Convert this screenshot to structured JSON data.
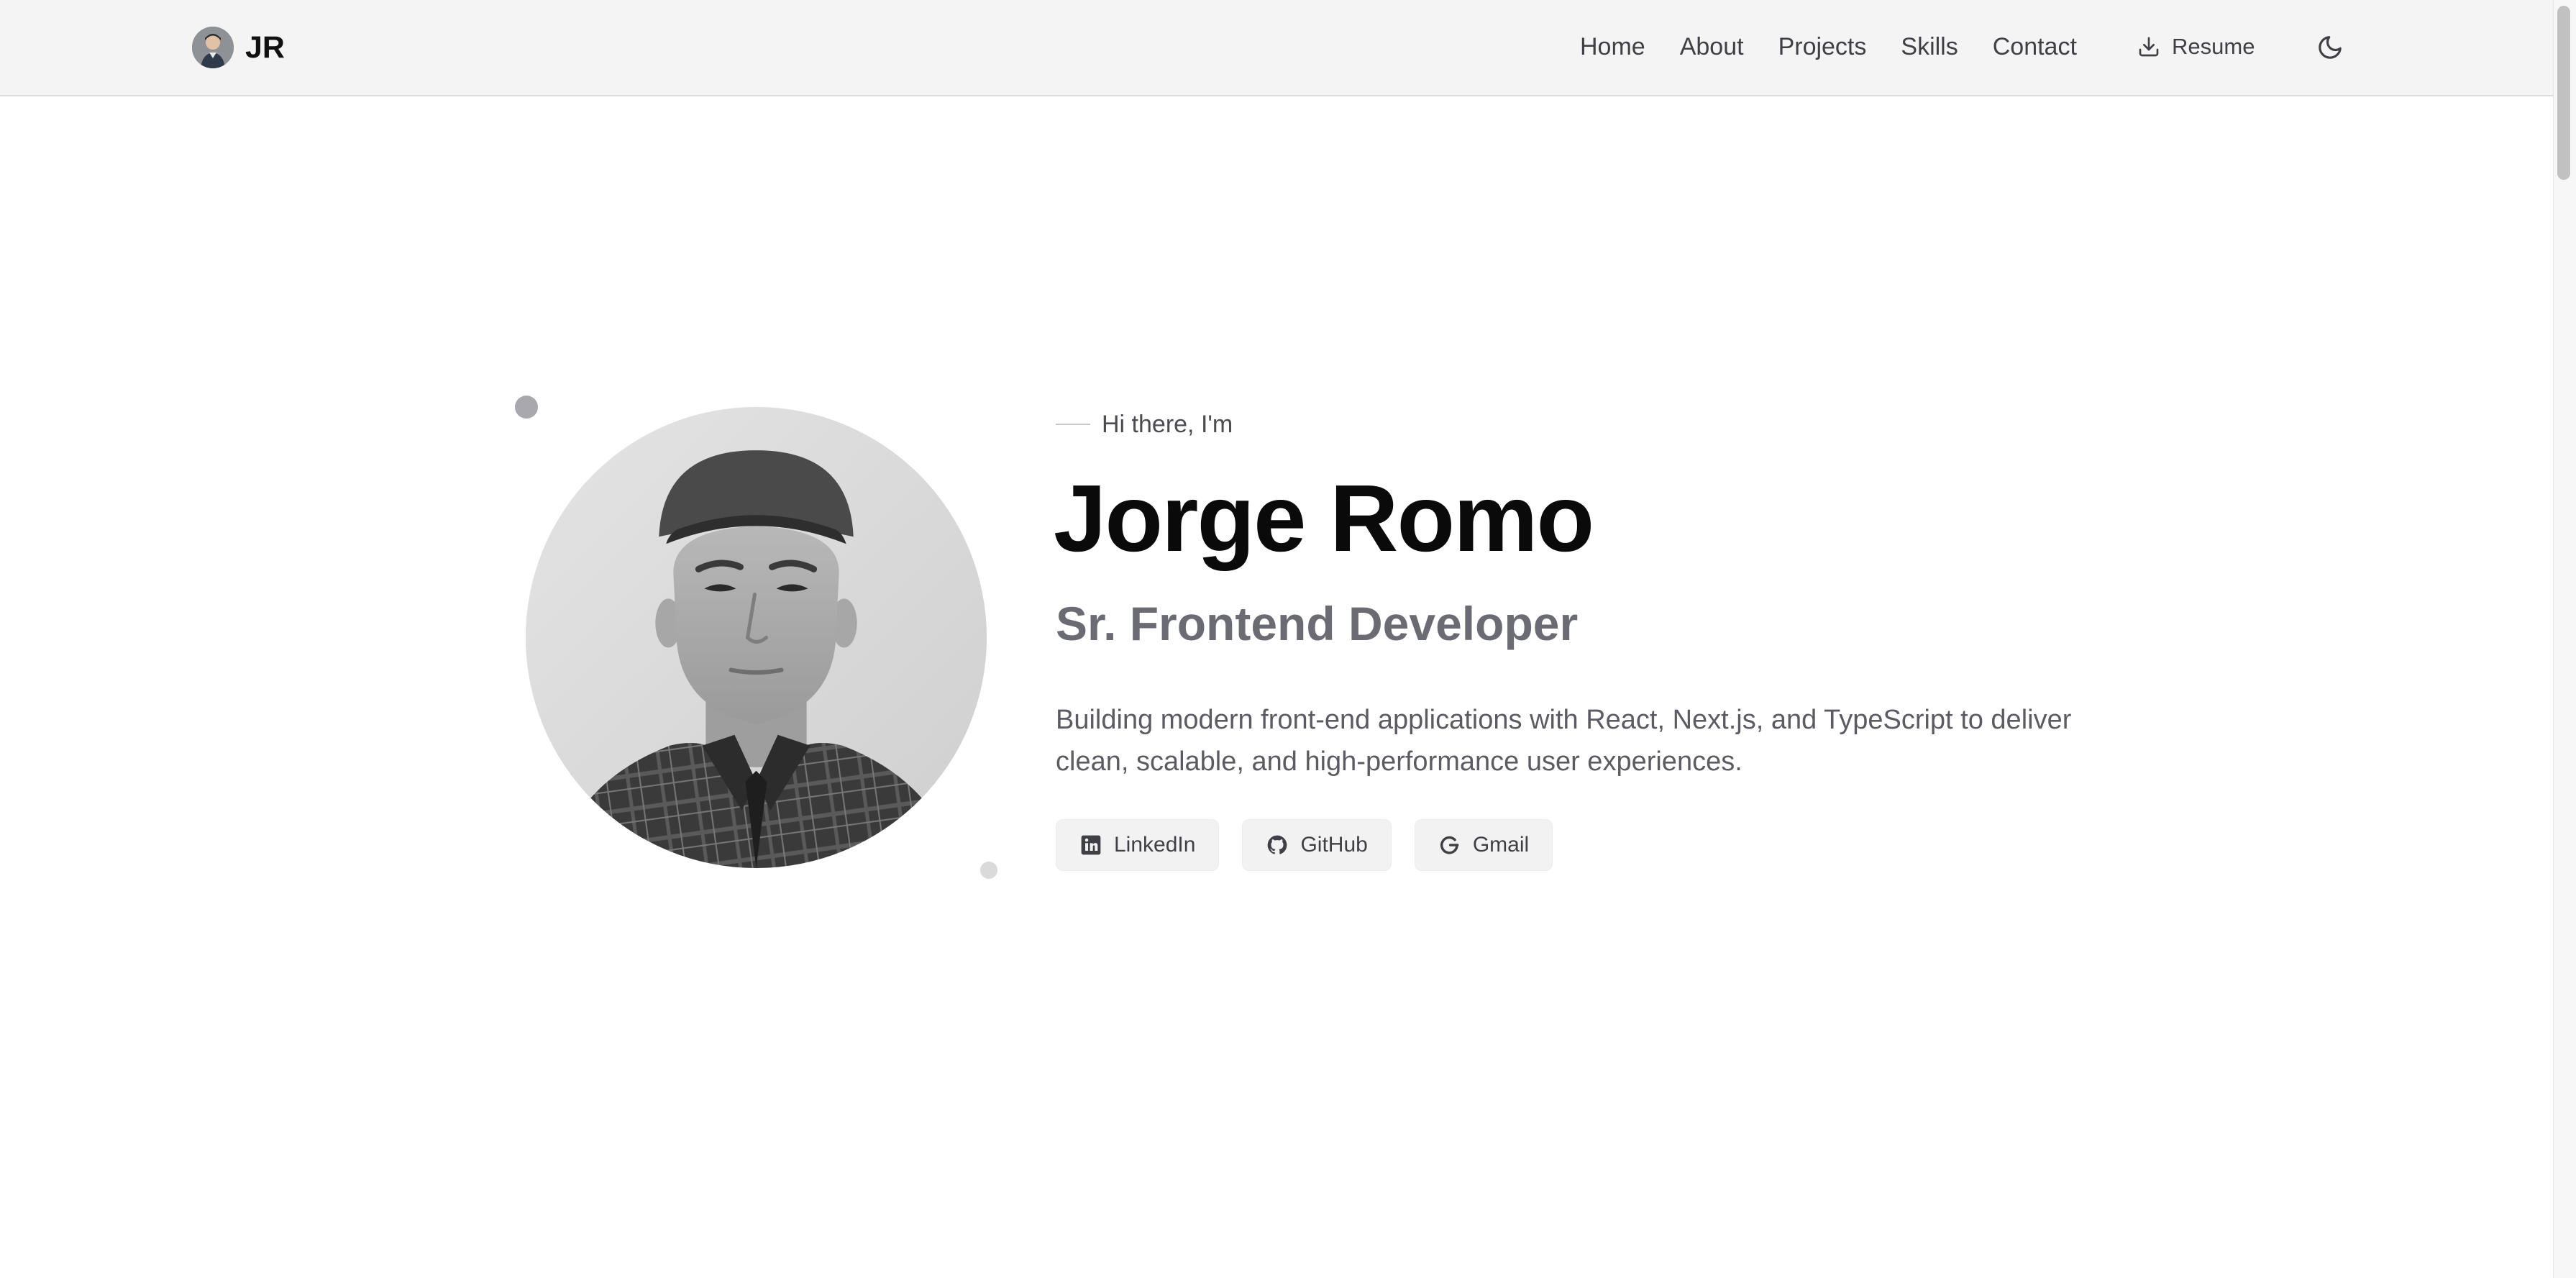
{
  "brand": {
    "initials": "JR"
  },
  "nav": {
    "items": [
      {
        "label": "Home"
      },
      {
        "label": "About"
      },
      {
        "label": "Projects"
      },
      {
        "label": "Skills"
      },
      {
        "label": "Contact"
      }
    ],
    "resume_label": "Resume",
    "theme_icon": "moon-icon"
  },
  "hero": {
    "greeting": "Hi there, I'm",
    "name": "Jorge Romo",
    "role": "Sr. Frontend Developer",
    "bio": "Building modern front-end applications with React, Next.js, and TypeScript to deliver clean, scalable, and high-performance user experiences.",
    "socials": [
      {
        "label": "LinkedIn",
        "icon": "linkedin-icon"
      },
      {
        "label": "GitHub",
        "icon": "github-icon"
      },
      {
        "label": "Gmail",
        "icon": "google-icon"
      }
    ]
  },
  "colors": {
    "header_bg": "#f4f4f4",
    "heading": "#0a0a0a",
    "muted": "#6b6b73",
    "button_bg": "#f2f2f2"
  }
}
